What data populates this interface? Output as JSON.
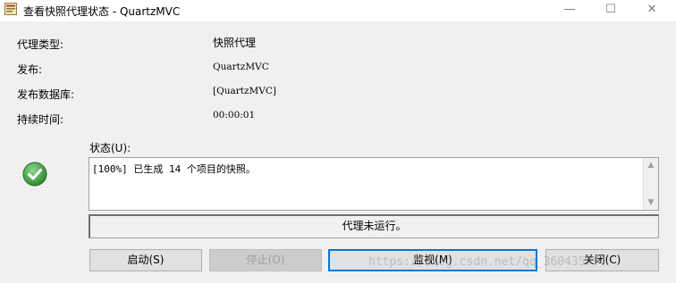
{
  "window": {
    "title": "查看快照代理状态 - QuartzMVC",
    "minimize_symbol": "—",
    "maximize_symbol": "☐",
    "close_symbol": "✕",
    "app_icon": "agent-app-icon"
  },
  "info": {
    "agent_type_label": "代理类型:",
    "agent_type_value": "快照代理",
    "publisher_label": "发布:",
    "publisher_value": "QuartzMVC",
    "pub_db_label": "发布数据库:",
    "pub_db_value": "[QuartzMVC]",
    "duration_label": "持续时间:",
    "duration_value": "00:00:01"
  },
  "status": {
    "label": "状态(U):",
    "icon": "success-check-icon",
    "text": "[100%] 已生成 14 个项目的快照。",
    "agent_state": "代理未运行。",
    "scroll_up": "▲",
    "scroll_down": "▼"
  },
  "buttons": {
    "start": "启动(S)",
    "stop": "停止(O)",
    "monitor": "监视(M)",
    "close": "关闭(C)"
  },
  "watermark": "https://blog.csdn.net/qq_36043577",
  "colors": {
    "accent": "#0078d7",
    "check_green": "#3a9a3a",
    "background": "#f0f0f0"
  }
}
